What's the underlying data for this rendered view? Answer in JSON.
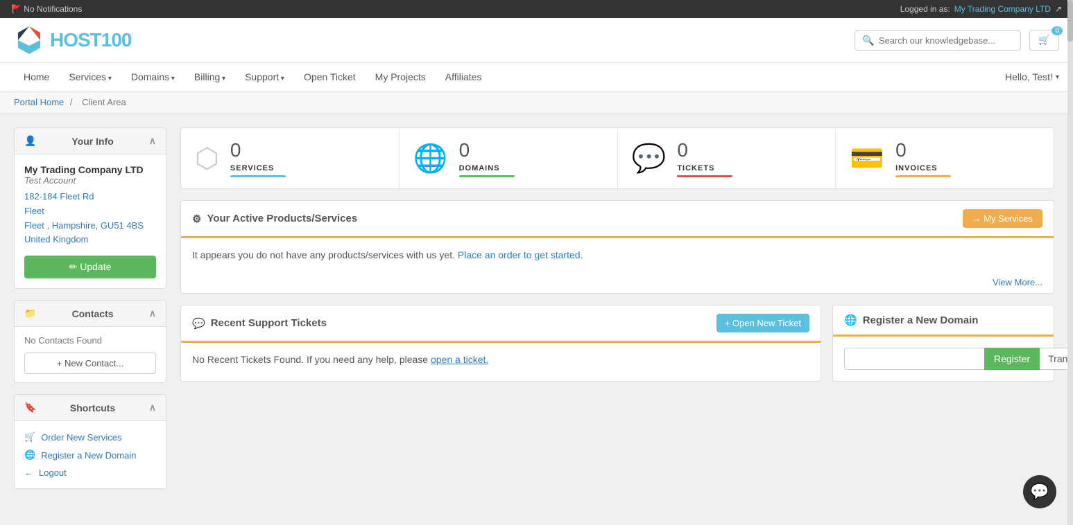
{
  "topbar": {
    "notifications": "No Notifications",
    "logged_in_label": "Logged in as:",
    "company": "My Trading Company LTD"
  },
  "header": {
    "logo_text_host": "HOST",
    "logo_text_number": "100",
    "search_placeholder": "Search our knowledgebase...",
    "cart_count": "0"
  },
  "nav": {
    "items": [
      {
        "label": "Home",
        "has_dropdown": false
      },
      {
        "label": "Services",
        "has_dropdown": true
      },
      {
        "label": "Domains",
        "has_dropdown": true
      },
      {
        "label": "Billing",
        "has_dropdown": true
      },
      {
        "label": "Support",
        "has_dropdown": true
      },
      {
        "label": "Open Ticket",
        "has_dropdown": false
      },
      {
        "label": "My Projects",
        "has_dropdown": false
      },
      {
        "label": "Affiliates",
        "has_dropdown": false
      }
    ],
    "hello_user": "Hello, Test!"
  },
  "breadcrumb": {
    "portal_home": "Portal Home",
    "separator": "/",
    "current": "Client Area"
  },
  "sidebar": {
    "your_info_title": "Your Info",
    "company_name": "My Trading Company LTD",
    "account_type": "Test Account",
    "address1": "182-184 Fleet Rd",
    "address2": "Fleet",
    "address3": "Fleet , Hampshire, GU51 4BS",
    "address4": "United Kingdom",
    "update_btn": "✏ Update",
    "contacts_title": "Contacts",
    "no_contacts": "No Contacts Found",
    "new_contact_btn": "+ New Contact...",
    "shortcuts_title": "Shortcuts",
    "shortcuts": [
      {
        "label": "Order New Services",
        "icon": "🛒"
      },
      {
        "label": "Register a New Domain",
        "icon": "🌐"
      },
      {
        "label": "Logout",
        "icon": "←"
      }
    ]
  },
  "stats": [
    {
      "number": "0",
      "label": "SERVICES",
      "bar_class": "bar-blue"
    },
    {
      "number": "0",
      "label": "DOMAINS",
      "bar_class": "bar-green"
    },
    {
      "number": "0",
      "label": "TICKETS",
      "bar_class": "bar-red"
    },
    {
      "number": "0",
      "label": "INVOICES",
      "bar_class": "bar-orange"
    }
  ],
  "products": {
    "title": "Your Active Products/Services",
    "my_services_btn": "→ My Services",
    "empty_text": "It appears you do not have any products/services with us yet.",
    "order_link": "Place an order to get started.",
    "view_more": "View More..."
  },
  "support": {
    "title": "Recent Support Tickets",
    "open_ticket_btn": "+ Open New Ticket",
    "no_tickets": "No Recent Tickets Found. If you need any help, please",
    "open_ticket_link": "open a ticket."
  },
  "domain": {
    "title": "Register a New Domain",
    "input_placeholder": "",
    "register_btn": "Register",
    "transfer_btn": "Transfer"
  },
  "chat_icon": "💬"
}
